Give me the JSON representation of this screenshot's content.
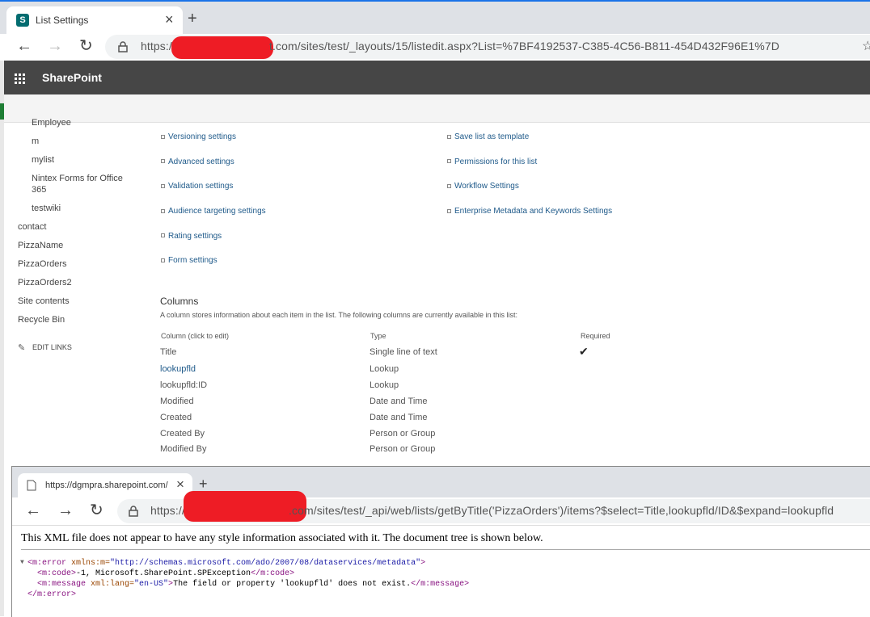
{
  "top_browser": {
    "tab_title": "List Settings",
    "new_tab": "+",
    "close_tab": "×",
    "url_prefix": "https://",
    "url_rest": "t.com/sites/test/_layouts/15/listedit.aspx?List=%7BF4192537-C385-4C56-B811-454D432F96E1%7D",
    "favicon_letter": "S"
  },
  "sharepoint": {
    "brand": "SharePoint",
    "nav_sub": [
      "Employee",
      "m",
      "mylist",
      "Nintex Forms for Office 365",
      "testwiki"
    ],
    "nav": [
      "contact",
      "PizzaName",
      "PizzaOrders",
      "PizzaOrders2",
      "Site contents",
      "Recycle Bin"
    ],
    "edit_links": "EDIT LINKS",
    "settings_left": [
      "Versioning settings",
      "Advanced settings",
      "Validation settings",
      "Audience targeting settings",
      "Rating settings",
      "Form settings"
    ],
    "settings_right": [
      "Save list as template",
      "Permissions for this list",
      "Workflow Settings",
      "Enterprise Metadata and Keywords Settings"
    ],
    "columns": {
      "heading": "Columns",
      "description": "A column stores information about each item in the list. The following columns are currently available in this list:",
      "headers": [
        "Column (click to edit)",
        "Type",
        "Required"
      ],
      "rows": [
        {
          "name": "Title",
          "type": "Single line of text",
          "required": "✔"
        },
        {
          "name": "lookupfld",
          "type": "Lookup",
          "required": ""
        },
        {
          "name": "lookupfld:ID",
          "type": "Lookup",
          "required": ""
        },
        {
          "name": "Modified",
          "type": "Date and Time",
          "required": ""
        },
        {
          "name": "Created",
          "type": "Date and Time",
          "required": ""
        },
        {
          "name": "Created By",
          "type": "Person or Group",
          "required": ""
        },
        {
          "name": "Modified By",
          "type": "Person or Group",
          "required": ""
        }
      ]
    }
  },
  "bottom_browser": {
    "tab_title": "https://dgmpra.sharepoint.com/",
    "new_tab": "+",
    "close_tab": "×",
    "url_prefix": "https://",
    "url_rest": ".com/sites/test/_api/web/lists/getByTitle('PizzaOrders')/items?$select=Title,lookupfld/ID&$expand=lookupfld",
    "xml_note": "This XML file does not appear to have any style information associated with it. The document tree is shown below.",
    "xml": {
      "error_open_tag": "<m:error",
      "error_attr": " xmlns:m=",
      "error_attr_val": "\"http://schemas.microsoft.com/ado/2007/08/dataservices/metadata\"",
      "code_open": "<m:code>",
      "code_text": "-1, Microsoft.SharePoint.SPException",
      "code_close": "</m:code>",
      "msg_open": "<m:message",
      "msg_attr": " xml:lang=",
      "msg_attr_val": "\"en-US\"",
      "msg_text": "The field or property 'lookupfld' does not exist.",
      "msg_close": "</m:message>",
      "error_close": "</m:error>",
      "toggle": "▼"
    }
  },
  "colors": {
    "suite_bar": "#464646",
    "link_blue": "#1f5a8a",
    "redaction": "#ee1c25",
    "tab_strip": "#dee1e6"
  }
}
